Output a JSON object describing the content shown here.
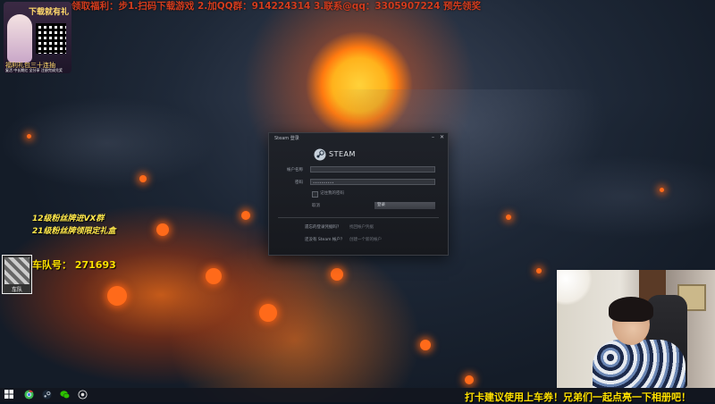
{
  "overlay": {
    "top_banner": "领取福利：步1.扫码下载游戏 2.加QQ群：914224314 3.联系@qq：3305907224 预先领奖",
    "logo": {
      "title": "下载就有礼",
      "subtitle": "福利礼包三十连抽",
      "caption": "复活 中长期红 全分享 注册完成兑奖"
    },
    "side_lines": [
      "12级粉丝牌进VX群",
      "21级粉丝牌领限定礼盒"
    ],
    "fleet_avatar_caption": "车队",
    "fleet_label": "车队号：",
    "fleet_number": "271693",
    "bottom_ticker": "打卡建议使用上车券！兄弟们一起点亮一下相册吧！"
  },
  "steam_login": {
    "window_title": "Steam 登录",
    "minimize_icon": "minimize-icon",
    "close_icon": "close-icon",
    "brand": "STEAM",
    "account_label": "帐户名称",
    "account_value": "",
    "password_label": "密码",
    "password_value": "••••••••••",
    "remember_label": "记住我的密码",
    "cancel_label": "取消",
    "login_label": "登录",
    "forgot_question": "遗忘的登录凭据吗？",
    "forgot_link": "找回帐户凭据",
    "no_account_question": "还没有 Steam 帐户？",
    "create_link": "创建一个新的帐户"
  },
  "taskbar": {
    "icons": [
      "windows-start-icon",
      "chrome-icon",
      "steam-icon",
      "wechat-icon",
      "stream-app-icon"
    ]
  }
}
